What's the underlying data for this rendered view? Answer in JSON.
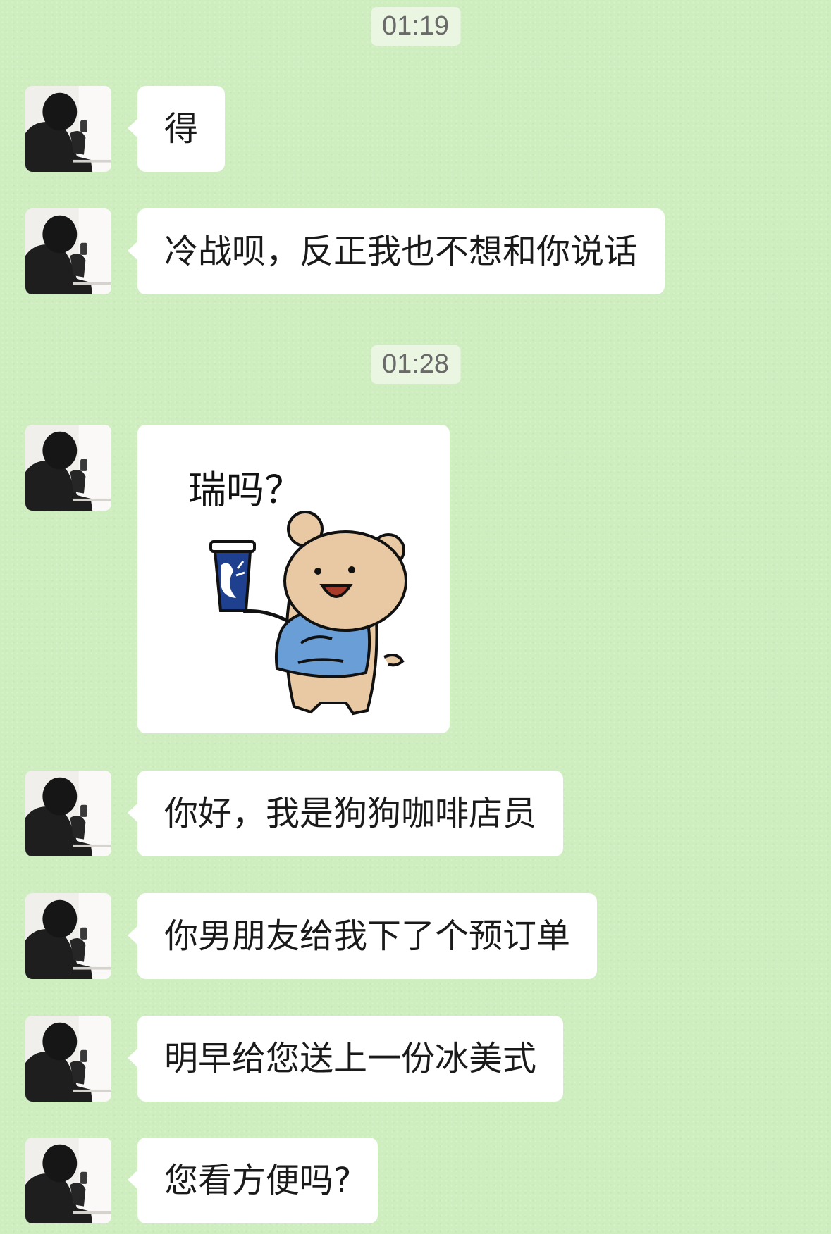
{
  "timestamps": [
    "01:19",
    "01:28"
  ],
  "messages": {
    "m1": "得",
    "m2": "冷战呗，反正我也不想和你说话",
    "m4": "你好，我是狗狗咖啡店员",
    "m5": "你男朋友给我下了个预订单",
    "m6": "明早给您送上一份冰美式",
    "m7": "您看方便吗?"
  },
  "sticker": {
    "caption": "瑞吗？",
    "icon": "bear-with-coffee-cup-sticker"
  },
  "colors": {
    "background": "#cfeec0",
    "bubble": "#ffffff",
    "apron": "#6a9ed6",
    "bear": "#e8c9a3",
    "cup": "#1f3f8f"
  }
}
